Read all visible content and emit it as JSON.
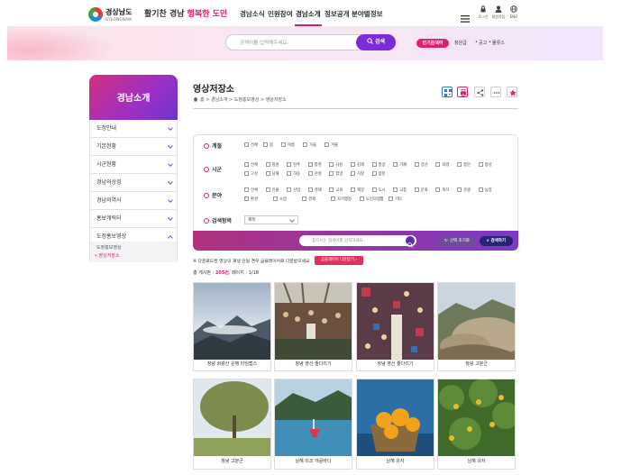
{
  "header": {
    "logo_text": "경상남도",
    "logo_sub": "GYEONGNAM",
    "slogan_pre": "활기찬 경남 ",
    "slogan_hl": "행복한 도민",
    "gnb": [
      "경남소식",
      "민원참여",
      "경남소개",
      "정보공개",
      "분야별정보"
    ],
    "util": [
      "로그인",
      "회원가입",
      "ENG"
    ]
  },
  "search": {
    "placeholder": "검색어를 입력해주세요.",
    "button": "검색",
    "popular_label": "인기검색어",
    "popular": [
      "창원급",
      "공고",
      "물류스"
    ]
  },
  "lnb": {
    "title": "경남소개",
    "items": [
      "도정안내",
      "기본현황",
      "시군현황",
      "경남의상징",
      "경남의역사",
      "홍보캐릭터",
      "도정홍보영상"
    ],
    "subs": [
      "도정홍보영상",
      "영상저장소"
    ]
  },
  "content": {
    "title": "영상저장소",
    "breadcrumb": "홈  >  경남소개  >  도정홍보영상  >  영상저장소"
  },
  "filter": {
    "season_label": "계절",
    "season": [
      "전체",
      "봄",
      "여름",
      "가을",
      "겨울"
    ],
    "city_label": "시군",
    "city_row1": [
      "전체",
      "창원",
      "진주",
      "통영",
      "사천",
      "김해",
      "밀양",
      "거제",
      "양산",
      "의령",
      "함안",
      "창녕"
    ],
    "city_row2": [
      "고성",
      "남해",
      "하동",
      "산청",
      "함양",
      "거창",
      "합천"
    ],
    "field_label": "분야",
    "field_row1": [
      "전체",
      "인물",
      "산업",
      "경제",
      "교육",
      "해양",
      "도시",
      "교통",
      "문화",
      "복지",
      "관광",
      "농업"
    ],
    "field_row2": [
      "환경",
      "소방",
      "경제",
      "자치행정",
      "도민의생활",
      "기타"
    ],
    "cond_label": "검색항목",
    "select_value": "제목",
    "kw_placeholder": "찾으시는 검색어를 입력하세요.",
    "reset": "선택 초기화",
    "submit": "검색하기"
  },
  "notice": {
    "text": "※ 다운로드된 영상의 재생 안될 경우 곰플레이어로 다운받으세요",
    "button": "곰플레이어 다운받기"
  },
  "count": {
    "pre": "총 게시판 : ",
    "total": "205건",
    "post": ", 페이지 : 1/18"
  },
  "gallery": [
    {
      "caption": "창녕 화왕산 운해 타임랩스",
      "icon": "misty-mountain-photo"
    },
    {
      "caption": "창녕 영산 줄다리기",
      "icon": "tug-of-war-crowd-photo"
    },
    {
      "caption": "창녕 영산 줄다리기",
      "icon": "festival-crowd-photo"
    },
    {
      "caption": "창녕 고분군",
      "icon": "burial-mounds-photo"
    },
    {
      "caption": "창녕 고분군",
      "icon": "tree-lawn-photo"
    },
    {
      "caption": "남해 미조 개굴바다",
      "icon": "harbor-boat-photo"
    },
    {
      "caption": "남해 유자",
      "icon": "yuzu-basket-photo"
    },
    {
      "caption": "남해 유자",
      "icon": "yuzu-tree-photo"
    }
  ],
  "colors": {
    "accent": "#e0206c",
    "purple": "#7b2bd8",
    "lnb_grad": "#b22fa5"
  }
}
